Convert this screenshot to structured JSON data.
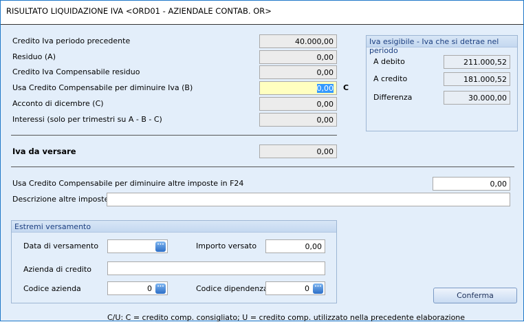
{
  "title": "RISULTATO LIQUIDAZIONE IVA <ORD01 - AZIENDALE CONTAB. OR>",
  "rows": [
    {
      "label": "Credito Iva periodo precedente",
      "value": "40.000,00"
    },
    {
      "label": "Residuo (A)",
      "value": "0,00"
    },
    {
      "label": "Credito Iva Compensabile residuo",
      "value": "0,00"
    },
    {
      "label": "Usa Credito Compensabile per diminuire Iva (B)",
      "value": "0,00",
      "flag": "C"
    },
    {
      "label": "Acconto di dicembre (C)",
      "value": "0,00"
    },
    {
      "label": "Interessi (solo per trimestri su A - B - C)",
      "value": "0,00"
    }
  ],
  "iva_da_versare": {
    "label": "Iva da versare",
    "value": "0,00"
  },
  "esigibile": {
    "title": "Iva esigibile - Iva che si detrae nel periodo",
    "debito_label": "A debito",
    "debito": "211.000,52",
    "credito_label": "A credito",
    "credito": "181.000,52",
    "diff_label": "Differenza",
    "diff": "30.000,00"
  },
  "altre": {
    "label": "Usa Credito Compensabile per diminuire altre imposte in F24",
    "value": "0,00",
    "desc_label": "Descrizione altre imposte",
    "desc_value": ""
  },
  "versamento": {
    "title": "Estremi versamento",
    "data_label": "Data di versamento",
    "data_value": "",
    "importo_label": "Importo versato",
    "importo_value": "0,00",
    "azienda_label": "Azienda di credito",
    "azienda_value": "",
    "codaz_label": "Codice azienda",
    "codaz_value": "0",
    "coddip_label": "Codice dipendenza",
    "coddip_value": "0",
    "dots": "···"
  },
  "confirm": "Conferma",
  "footer": "C/U: C = credito comp. consigliato; U = credito comp. utilizzato nella precedente elaborazione"
}
